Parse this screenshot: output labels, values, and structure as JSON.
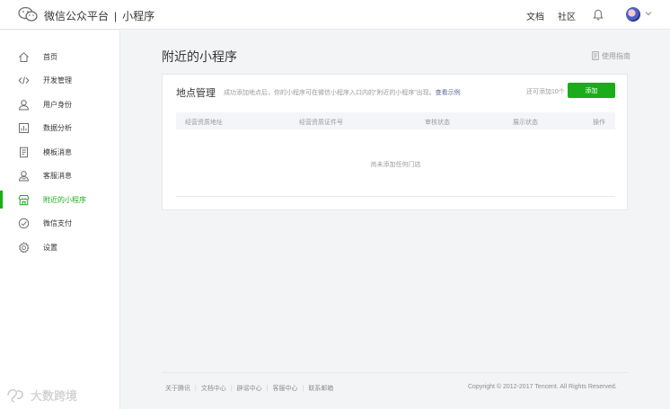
{
  "header": {
    "brand": "微信公众平台",
    "separator": "|",
    "product": "小程序",
    "links": [
      "文档",
      "社区"
    ],
    "icons": {
      "logo": "wechat-logo-icon",
      "bell": "bell-icon",
      "caret": "chevron-down-icon"
    }
  },
  "sidebar": {
    "items": [
      {
        "label": "首页",
        "icon": "home-icon"
      },
      {
        "label": "开发管理",
        "icon": "code-icon"
      },
      {
        "label": "用户身份",
        "icon": "user-icon"
      },
      {
        "label": "数据分析",
        "icon": "bar-chart-icon"
      },
      {
        "label": "模板消息",
        "icon": "document-icon"
      },
      {
        "label": "客服消息",
        "icon": "customer-service-icon"
      },
      {
        "label": "附近的小程序",
        "icon": "store-icon"
      },
      {
        "label": "微信支付",
        "icon": "payment-icon"
      },
      {
        "label": "设置",
        "icon": "gear-icon"
      }
    ],
    "active_index": 6
  },
  "main": {
    "title": "附近的小程序",
    "guide_label": "使用指南",
    "panel": {
      "title": "地点管理",
      "description": "成功添加地点后，你的小程序可在微信小程序入口内的“附近的小程序”出现。",
      "example_link": "查看示例",
      "quota": "还可添加10个",
      "add_button": "添加",
      "columns": [
        "经营资质地址",
        "经营资质证件号",
        "审核状态",
        "展示状态",
        "操作"
      ],
      "empty_text": "尚未添加任何门店"
    }
  },
  "footer": {
    "links": [
      "关于腾讯",
      "文档中心",
      "辟谣中心",
      "客服中心",
      "联系邮箱"
    ],
    "copyright": "Copyright © 2012-2017 Tencent. All Rights Reserved."
  },
  "watermark": {
    "text": "大数跨境"
  },
  "colors": {
    "accent": "#1aad19",
    "link": "#576b95",
    "background": "#f3f4f6"
  }
}
